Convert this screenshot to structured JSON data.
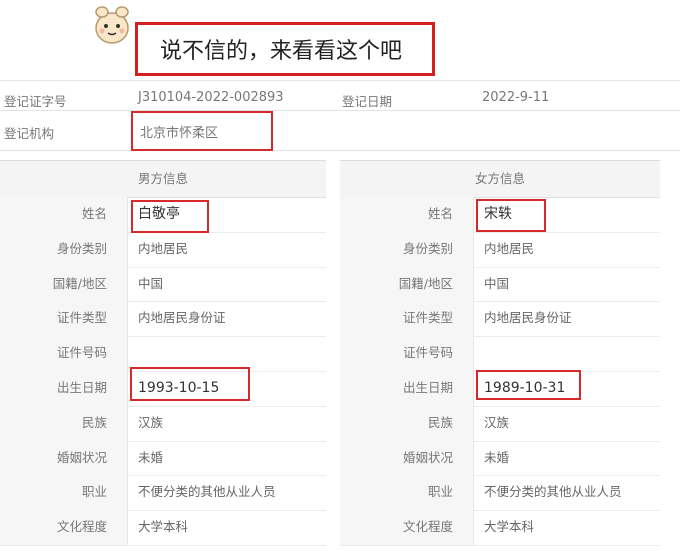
{
  "caption": "说不信的，来看看这个吧",
  "registration": {
    "cert_no_label": "登记证字号",
    "cert_no_value": "J310104-2022-002893",
    "date_label": "登记日期",
    "date_value": "2022-9-11",
    "org_label": "登记机构",
    "org_value": "北京市怀柔区"
  },
  "male": {
    "title": "男方信息",
    "rows": [
      {
        "label": "姓名",
        "value": "白敬亭"
      },
      {
        "label": "身份类别",
        "value": "内地居民"
      },
      {
        "label": "国籍/地区",
        "value": "中国"
      },
      {
        "label": "证件类型",
        "value": "内地居民身份证"
      },
      {
        "label": "证件号码",
        "value": ""
      },
      {
        "label": "出生日期",
        "value": "1993-10-15"
      },
      {
        "label": "民族",
        "value": "汉族"
      },
      {
        "label": "婚姻状况",
        "value": "未婚"
      },
      {
        "label": "职业",
        "value": "不便分类的其他从业人员"
      },
      {
        "label": "文化程度",
        "value": "大学本科"
      }
    ]
  },
  "female": {
    "title": "女方信息",
    "rows": [
      {
        "label": "姓名",
        "value": "宋轶"
      },
      {
        "label": "身份类别",
        "value": "内地居民"
      },
      {
        "label": "国籍/地区",
        "value": "中国"
      },
      {
        "label": "证件类型",
        "value": "内地居民身份证"
      },
      {
        "label": "证件号码",
        "value": ""
      },
      {
        "label": "出生日期",
        "value": "1989-10-31"
      },
      {
        "label": "民族",
        "value": "汉族"
      },
      {
        "label": "婚姻状况",
        "value": "未婚"
      },
      {
        "label": "职业",
        "value": "不便分类的其他从业人员"
      },
      {
        "label": "文化程度",
        "value": "大学本科"
      }
    ]
  },
  "colors": {
    "highlight": "#d42a2a"
  }
}
